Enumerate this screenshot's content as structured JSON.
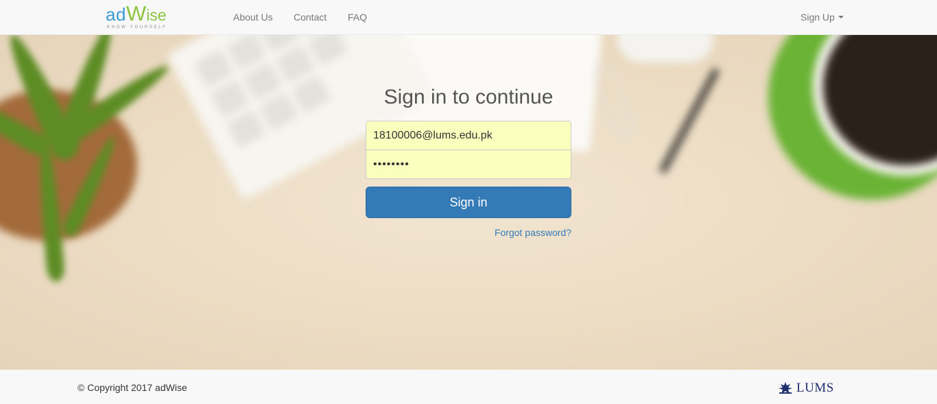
{
  "navbar": {
    "logo": {
      "part1": "ad",
      "part2": "W",
      "part3": "ise",
      "tagline": "KNOW YOURSELF"
    },
    "links": [
      {
        "label": "About Us"
      },
      {
        "label": "Contact"
      },
      {
        "label": "FAQ"
      }
    ],
    "signup_label": "Sign Up"
  },
  "form": {
    "title": "Sign in to continue",
    "email_value": "18100006@lums.edu.pk",
    "password_value": "••••••••",
    "submit_label": "Sign in",
    "forgot_label": "Forgot password?"
  },
  "footer": {
    "copyright": "© Copyright 2017 adWise",
    "partner_logo_text": "LUMS"
  },
  "colors": {
    "primary": "#337ab7",
    "autofill": "#faffbd",
    "logo_blue": "#3a9ad1",
    "logo_green": "#8cc43f"
  }
}
